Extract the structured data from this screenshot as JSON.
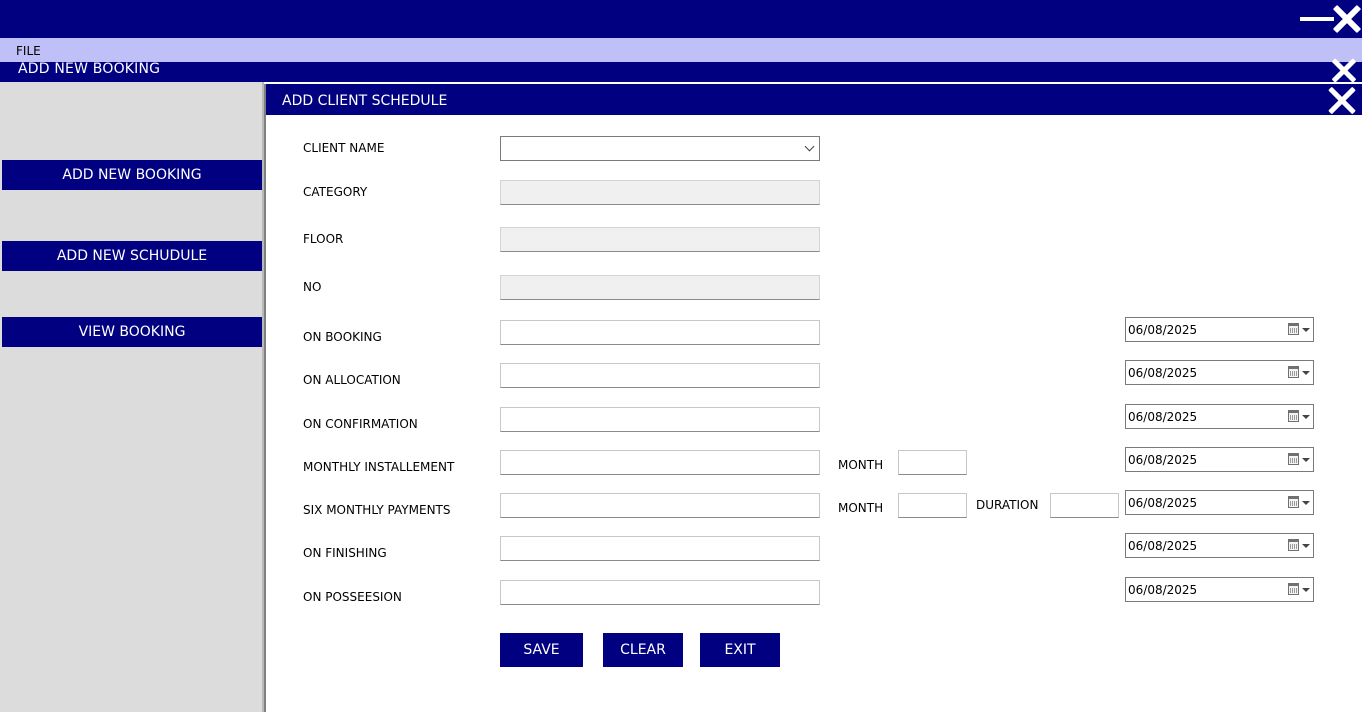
{
  "menu": {
    "file": "FILE"
  },
  "booking_window": {
    "title": "ADD NEW BOOKING"
  },
  "sidebar": {
    "add_booking": "ADD NEW BOOKING",
    "add_schedule": "ADD NEW SCHUDULE",
    "view_booking": "VIEW BOOKING"
  },
  "schedule": {
    "title": "ADD CLIENT SCHEDULE",
    "labels": {
      "client_name": "CLIENT NAME",
      "category": "CATEGORY",
      "floor": "FLOOR",
      "no": "NO",
      "on_booking": "ON BOOKING",
      "on_allocation": "ON ALLOCATION",
      "on_confirmation": "ON CONFIRMATION",
      "monthly_installement": "MONTHLY INSTALLEMENT",
      "six_monthly_payments": "SIX MONTHLY PAYMENTS",
      "on_finishing": "ON FINISHING",
      "on_posseesion": "ON POSSEESION",
      "month": "MONTH",
      "duration": "DURATION"
    },
    "values": {
      "client_name": "",
      "category": "",
      "floor": "",
      "no": "",
      "on_booking": "",
      "on_allocation": "",
      "on_confirmation": "",
      "monthly_installement": "",
      "monthly_month": "",
      "six_monthly_payments": "",
      "six_month": "",
      "six_duration": ""
    },
    "dates": {
      "on_booking": "06/08/2025",
      "on_allocation": "06/08/2025",
      "on_confirmation": "06/08/2025",
      "monthly_installement": "06/08/2025",
      "six_monthly_payments": "06/08/2025",
      "on_finishing": "06/08/2025",
      "on_posseesion": "06/08/2025"
    },
    "buttons": {
      "save": "SAVE",
      "clear": "CLEAR",
      "exit": "EXIT"
    }
  },
  "icons": {
    "minimize": "minimize-icon",
    "close": "close-icon",
    "calendar": "calendar-icon",
    "dropdown": "chevron-down-icon"
  },
  "colors": {
    "navy": "#000080",
    "menubar": "#c0c0f8",
    "sidebar": "#dcdcdc"
  }
}
